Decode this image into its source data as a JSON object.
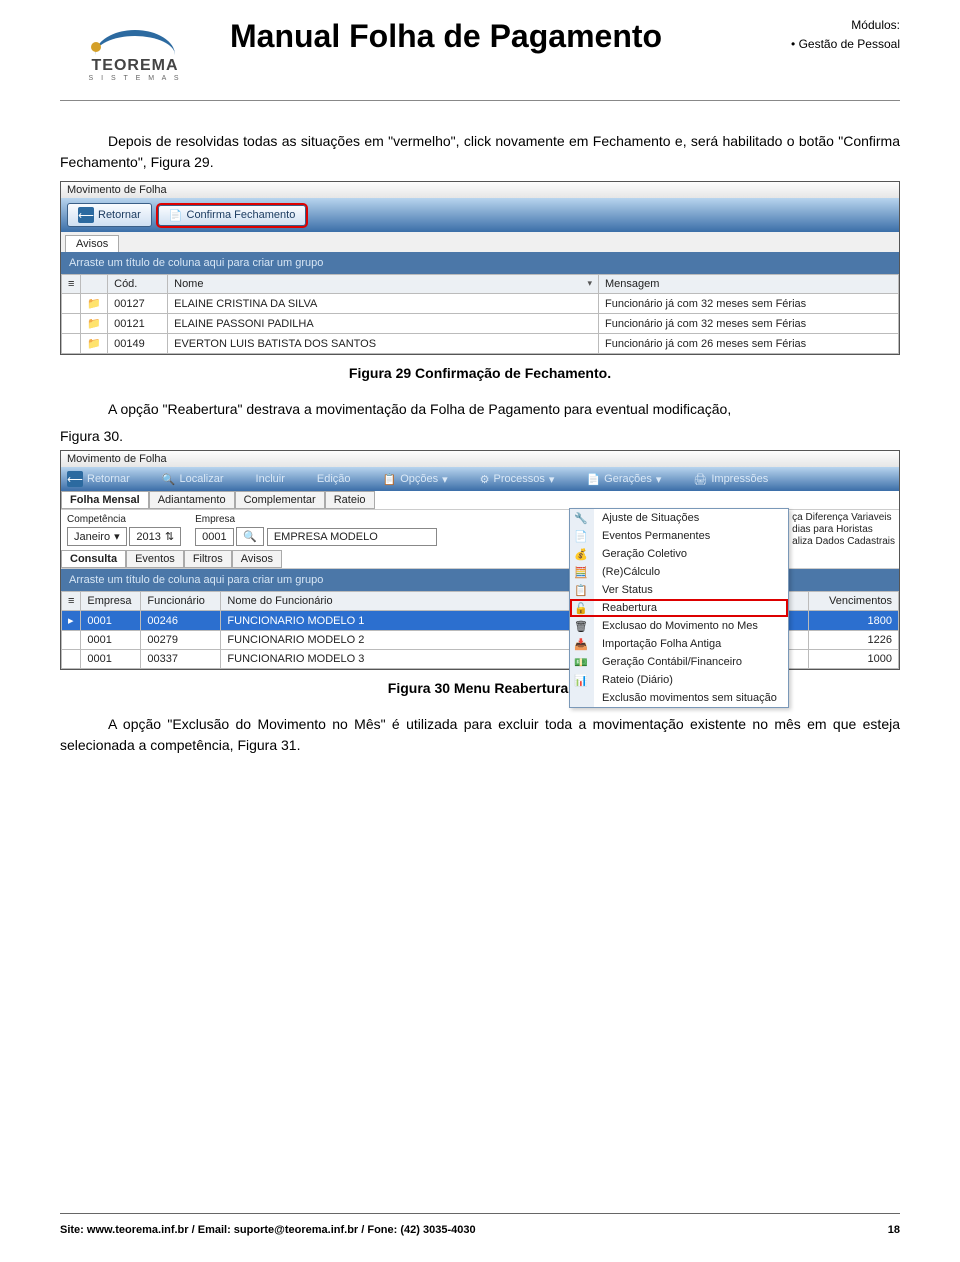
{
  "header": {
    "logo_text": "TEOREMA",
    "logo_sub": "S I S T E M A S",
    "page_title": "Manual Folha de Pagamento",
    "modules_label": "Módulos:",
    "module_item": "Gestão de Pessoal"
  },
  "body": {
    "para1": "Depois de resolvidas todas as situações em \"vermelho\", click novamente em Fechamento e, será habilitado o botão \"Confirma Fechamento\", Figura 29.",
    "caption1": "Figura 29 Confirmação de Fechamento.",
    "para2_pre": "A opção \"Reabertura\" destrava a movimentação da Folha de Pagamento para eventual modificação,",
    "fig30_ref": "Figura 30.",
    "caption2": "Figura 30 Menu Reabertura.",
    "para3": "A opção \"Exclusão do Movimento no Mês\" é utilizada para excluir toda a movimentação existente no mês em que esteja selecionada a competência, Figura 31."
  },
  "shot1": {
    "title": "Movimento de Folha",
    "btn_retornar": "Retornar",
    "btn_confirma": "Confirma Fechamento",
    "tab_avisos": "Avisos",
    "group_hint": "Arraste um título de coluna aqui para criar um grupo",
    "cols": {
      "cod": "Cód.",
      "nome": "Nome",
      "mensagem": "Mensagem"
    },
    "rows": [
      {
        "cod": "00127",
        "nome": "ELAINE CRISTINA DA SILVA",
        "msg": "Funcionário já com 32 meses sem Férias"
      },
      {
        "cod": "00121",
        "nome": "ELAINE PASSONI PADILHA",
        "msg": "Funcionário já com 32 meses sem Férias"
      },
      {
        "cod": "00149",
        "nome": "EVERTON LUIS BATISTA DOS SANTOS",
        "msg": "Funcionário já com 26 meses sem Férias"
      }
    ]
  },
  "shot2": {
    "title": "Movimento de Folha",
    "tb": {
      "retornar": "Retornar",
      "localizar": "Localizar",
      "incluir": "Incluir",
      "edicao": "Edição",
      "opcoes": "Opções",
      "processos": "Processos",
      "geracoes": "Gerações",
      "impressoes": "Impressões"
    },
    "tabs": {
      "mensal": "Folha Mensal",
      "adiant": "Adiantamento",
      "compl": "Complementar",
      "rateio": "Rateio"
    },
    "fields": {
      "competencia_label": "Competência",
      "competencia_mes": "Janeiro",
      "competencia_ano": "2013",
      "empresa_label": "Empresa",
      "empresa_cod": "0001",
      "empresa_nome": "EMPRESA MODELO"
    },
    "subtabs": {
      "consulta": "Consulta",
      "eventos": "Eventos",
      "filtros": "Filtros",
      "avisos": "Avisos"
    },
    "group_hint": "Arraste um título de coluna aqui para criar um grupo",
    "cols": {
      "empresa": "Empresa",
      "func": "Funcionário",
      "nome": "Nome do Funcionário",
      "venc": "Vencimentos"
    },
    "rows": [
      {
        "emp": "0001",
        "func": "00246",
        "nome": "FUNCIONARIO MODELO 1",
        "venc": "1800"
      },
      {
        "emp": "0001",
        "func": "00279",
        "nome": "FUNCIONARIO MODELO 2",
        "venc": "1226"
      },
      {
        "emp": "0001",
        "func": "00337",
        "nome": "FUNCIONARIO MODELO 3",
        "venc": "1000"
      }
    ],
    "menu": {
      "ajuste": "Ajuste de Situações",
      "eventos_perm": "Eventos Permanentes",
      "geracao_col": "Geração Coletivo",
      "recalculo": "(Re)Cálculo",
      "ver_status": "Ver Status",
      "reabertura": "Reabertura",
      "exclusao_mes": "Exclusao do Movimento no Mes",
      "import_antiga": "Importação Folha Antiga",
      "ger_contabil": "Geração Contábil/Financeiro",
      "rateio_diario": "Rateio (Diário)",
      "excl_sem_sit": "Exclusão movimentos sem situação"
    },
    "right_strip": {
      "l1": "ça Diferença Variaveis",
      "l2": "dias para Horistas",
      "l3": "aliza Dados Cadastrais"
    }
  },
  "footer": {
    "left": "Site: www.teorema.inf.br / Email: suporte@teorema.inf.br / Fone: (42) 3035-4030",
    "page": "18"
  }
}
